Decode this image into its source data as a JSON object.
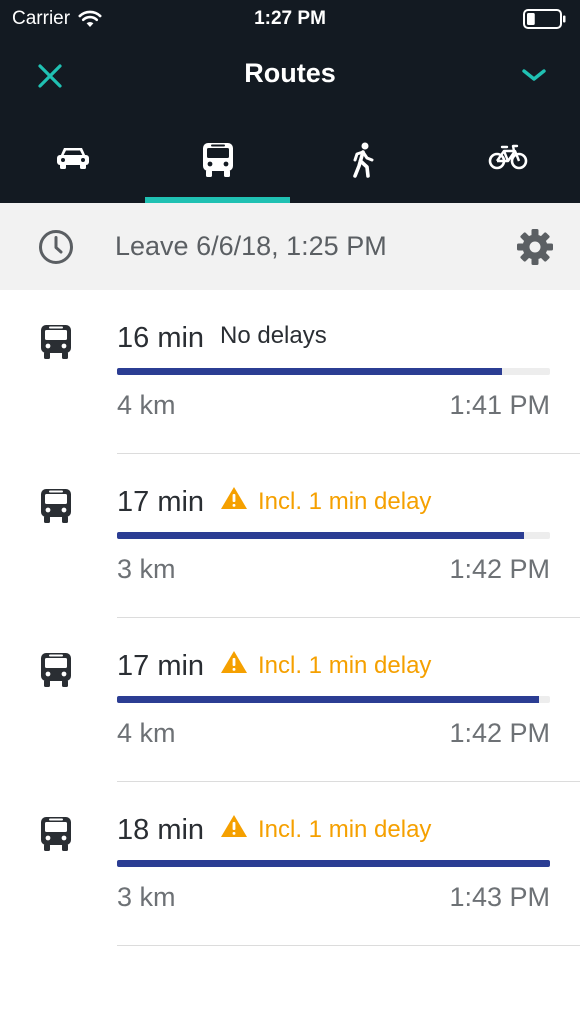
{
  "status_bar": {
    "carrier": "Carrier",
    "time": "1:27 PM",
    "battery_level": 0.25
  },
  "nav": {
    "title": "Routes",
    "close_icon": "close-icon",
    "expand_icon": "chevron-down-icon"
  },
  "modes": [
    {
      "name": "car",
      "icon": "car-icon",
      "active": false
    },
    {
      "name": "transit",
      "icon": "bus-icon",
      "active": true
    },
    {
      "name": "walk",
      "icon": "walking-icon",
      "active": false
    },
    {
      "name": "bike",
      "icon": "bicycle-icon",
      "active": false
    }
  ],
  "departure": {
    "label": "Leave 6/6/18, 1:25 PM",
    "icon": "clock-icon",
    "settings_icon": "gear-icon"
  },
  "routes": [
    {
      "duration": "16 min",
      "status": "No delays",
      "has_delay": false,
      "distance": "4 km",
      "arrival": "1:41 PM",
      "progress": 0.89
    },
    {
      "duration": "17 min",
      "status": "Incl. 1 min delay",
      "has_delay": true,
      "distance": "3 km",
      "arrival": "1:42 PM",
      "progress": 0.94
    },
    {
      "duration": "17 min",
      "status": "Incl. 1 min delay",
      "has_delay": true,
      "distance": "4 km",
      "arrival": "1:42 PM",
      "progress": 0.975
    },
    {
      "duration": "18 min",
      "status": "Incl. 1 min delay",
      "has_delay": true,
      "distance": "3 km",
      "arrival": "1:43 PM",
      "progress": 1.0
    }
  ],
  "colors": {
    "header_bg": "#131a22",
    "accent": "#20c1b3",
    "progress": "#2b3d93",
    "delay": "#f5a000"
  }
}
